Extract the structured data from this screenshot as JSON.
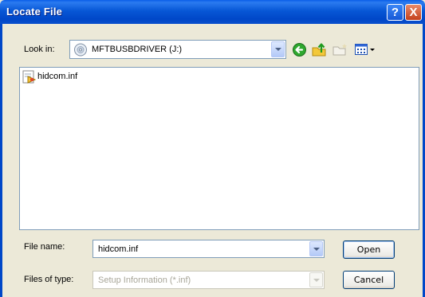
{
  "window": {
    "title": "Locate File"
  },
  "titlebar_buttons": {
    "help": "?",
    "close": "X"
  },
  "lookin": {
    "label": "Look in:",
    "value": "MFTBUSBDRIVER (J:)"
  },
  "toolbar": {
    "icons": [
      "back-icon",
      "up-folder-icon",
      "new-folder-icon",
      "views-menu-icon"
    ]
  },
  "files": [
    {
      "name": "hidcom.inf",
      "icon": "setup-file-icon"
    }
  ],
  "filename": {
    "label": "File name:",
    "value": "hidcom.inf"
  },
  "filetype": {
    "label": "Files of type:",
    "value": "Setup Information (*.inf)"
  },
  "buttons": {
    "open": "Open",
    "cancel": "Cancel"
  }
}
